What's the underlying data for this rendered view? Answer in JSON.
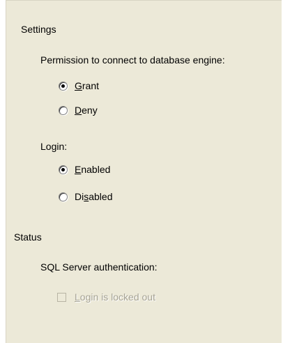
{
  "settings": {
    "heading": "Settings",
    "permission_label": "Permission to connect to database engine:",
    "permission_options": [
      {
        "pre": "",
        "key": "G",
        "post": "rant",
        "checked": true
      },
      {
        "pre": "",
        "key": "D",
        "post": "eny",
        "checked": false
      }
    ],
    "login_label": "Login:",
    "login_options": [
      {
        "pre": "",
        "key": "E",
        "post": "nabled",
        "checked": true
      },
      {
        "pre": "Di",
        "key": "s",
        "post": "abled",
        "checked": false
      }
    ]
  },
  "status": {
    "heading": "Status",
    "sql_auth_label": "SQL Server authentication:",
    "locked_out": {
      "key": "L",
      "post": "ogin is locked out",
      "checked": false,
      "enabled": false
    }
  }
}
